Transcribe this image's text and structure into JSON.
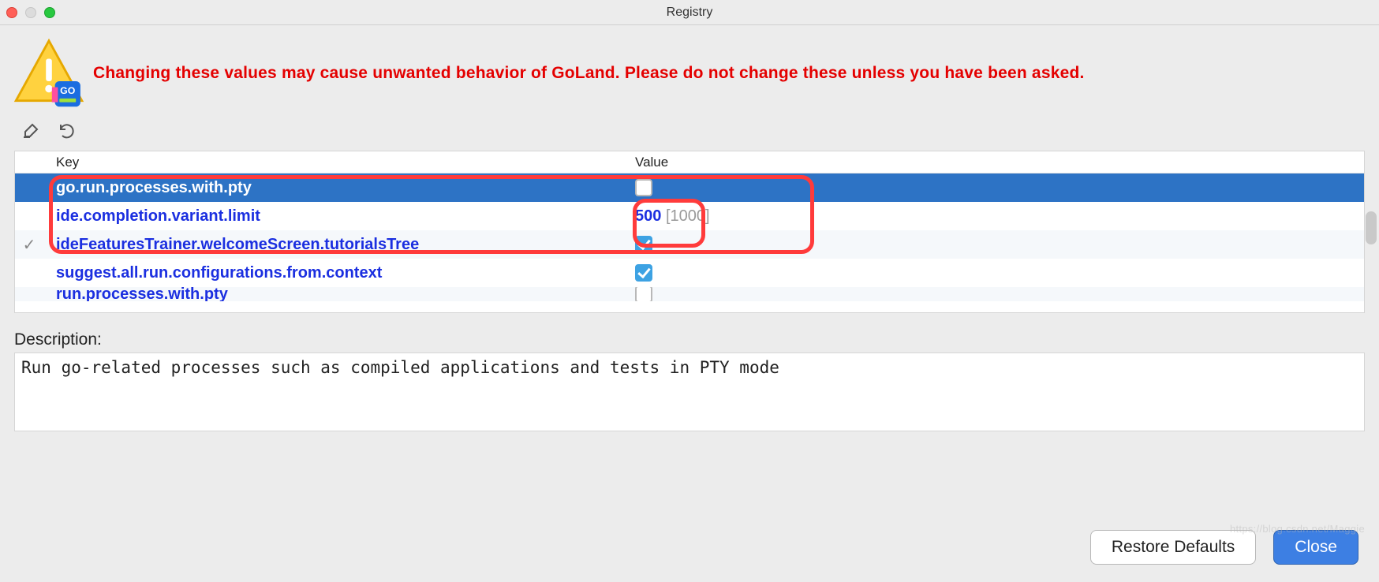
{
  "title": "Registry",
  "warning": "Changing these values may cause unwanted behavior of GoLand. Please do not change these unless you have been asked.",
  "columns": {
    "key": "Key",
    "value": "Value"
  },
  "rows": [
    {
      "key": "go.run.processes.with.pty",
      "type": "checkbox",
      "checked": false,
      "selected": true,
      "marker": ""
    },
    {
      "key": "ide.completion.variant.limit",
      "type": "text",
      "value": "500",
      "default": "[1000]",
      "marker": ""
    },
    {
      "key": "ideFeaturesTrainer.welcomeScreen.tutorialsTree",
      "type": "checkbox",
      "checked": true,
      "marker": "✓"
    },
    {
      "key": "suggest.all.run.configurations.from.context",
      "type": "checkbox",
      "checked": true,
      "marker": ""
    },
    {
      "key": "run.processes.with.pty",
      "type": "checkbox",
      "checked": false,
      "marker": ""
    }
  ],
  "description_label": "Description:",
  "description": "Run go-related processes such as compiled applications and tests in PTY mode",
  "buttons": {
    "restore": "Restore Defaults",
    "close": "Close"
  },
  "watermark": "https://blog.csdn.net/Maggie"
}
